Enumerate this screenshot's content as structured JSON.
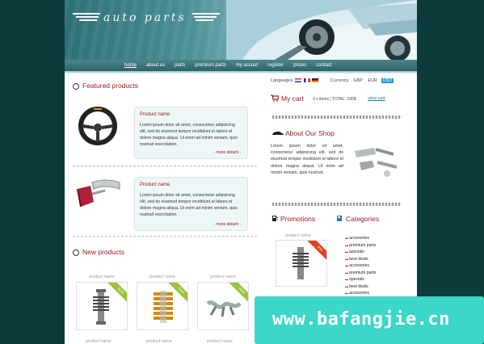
{
  "header": {
    "logo_text": "auto parts"
  },
  "nav": [
    "home",
    "about us",
    "parts",
    "premium parts",
    "my accout",
    "register",
    "prices",
    "contact"
  ],
  "featured": {
    "title": "Featured products",
    "products": [
      {
        "name": "Product name",
        "desc": "Lorem ipsum dolor sit amet, consectetur adipisicing elit, sed do eiusmod tempor incididunt ut labore et dolore magna aliqua. Ut enim ad minim veniam, quis nostrud exercitation.",
        "more": "- more details -"
      },
      {
        "name": "Product name",
        "desc": "Lorem ipsum dolor sit amet, consectetur adipisicing elit, sed do eiusmod tempor incididunt ut labore et dolore magna aliqua. Ut enim ad minim veniam, quis nostrud exercitation.",
        "more": "- more details -"
      }
    ]
  },
  "new_products": {
    "title": "New products",
    "items": [
      {
        "label": "product name",
        "badge": "NEW"
      },
      {
        "label": "product name",
        "badge": "NEW"
      },
      {
        "label": "product name",
        "badge": "NEW"
      }
    ],
    "items_row2": [
      "product name",
      "product name",
      "product name"
    ]
  },
  "top_bar": {
    "languages_label": "Languages:",
    "currency_label": "Currency:",
    "currencies": [
      "GBP",
      "EUR",
      "USD"
    ],
    "selected_currency": "USD"
  },
  "cart": {
    "title": "My cart",
    "summary": "3 x items | TOTAL: 100$",
    "view_link": "view cart"
  },
  "about": {
    "title": "About Our Shop",
    "text": "Lorem ipsum dolor sit amet, consectetur adipisicing elit, sed do eiusmod tempor incididunt ut labore et dolore magna aliqua. Ut enim ad minim veniam, quis nostrud."
  },
  "promotions": {
    "title": "Promotions",
    "item_label": "product name",
    "badge": "60%"
  },
  "categories": {
    "title": "Categories",
    "items": [
      "accesories",
      "premium parts",
      "specials",
      "best deals",
      "accesories",
      "premium parts",
      "specials",
      "best deals",
      "accesories"
    ]
  },
  "watermark": "www.bafangjie.cn",
  "colors": {
    "accent": "#9a1b23",
    "nav": "#3a7377",
    "page_bg": "#0d3a3a",
    "watermark_bg": "#3bd7c9"
  }
}
